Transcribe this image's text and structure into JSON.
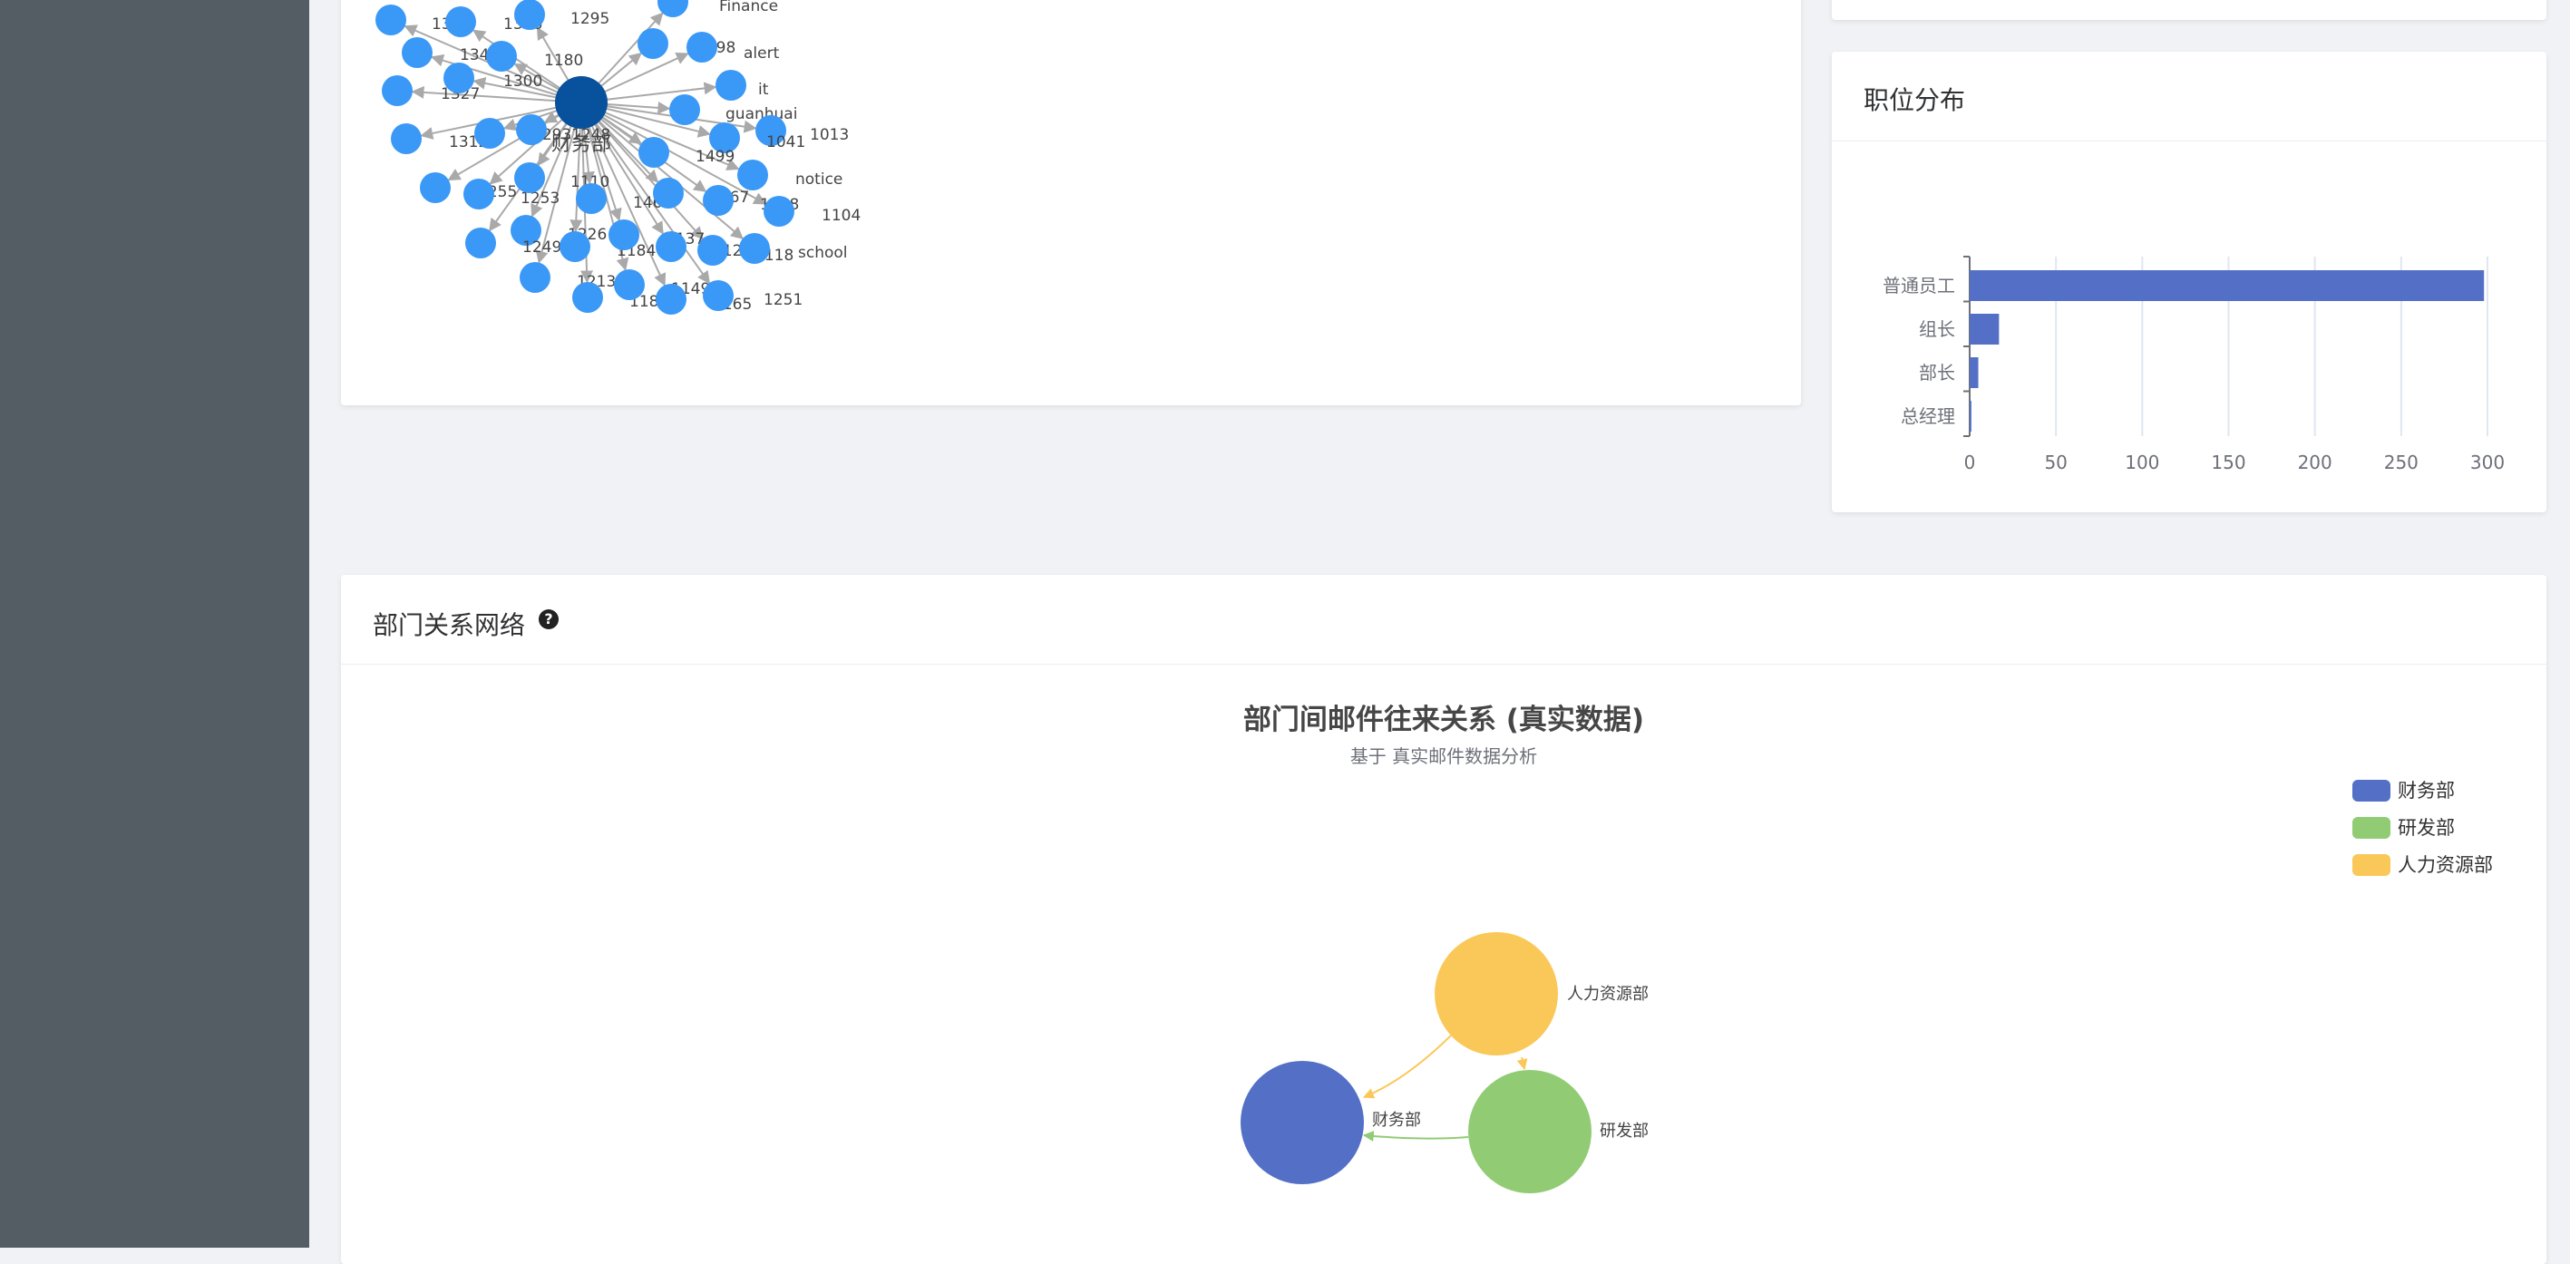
{
  "ego_network": {
    "center": {
      "label": "财务部",
      "color": "#08519c"
    },
    "nodes": [
      {
        "label": "1347"
      },
      {
        "label": "1346"
      },
      {
        "label": "1295"
      },
      {
        "label": "Finance"
      },
      {
        "label": "1342"
      },
      {
        "label": "1180"
      },
      {
        "label": "1498"
      },
      {
        "label": "alert"
      },
      {
        "label": "1327"
      },
      {
        "label": "1300"
      },
      {
        "label": "it"
      },
      {
        "label": "1312"
      },
      {
        "label": "1293"
      },
      {
        "label": "1248"
      },
      {
        "label": "guanhuai"
      },
      {
        "label": "1013"
      },
      {
        "label": "1041"
      },
      {
        "label": "1499"
      },
      {
        "label": "notice"
      },
      {
        "label": "1255"
      },
      {
        "label": "1253"
      },
      {
        "label": "1110"
      },
      {
        "label": "1467"
      },
      {
        "label": "1067"
      },
      {
        "label": "1108"
      },
      {
        "label": "1104"
      },
      {
        "label": "1226"
      },
      {
        "label": "1249"
      },
      {
        "label": "1184"
      },
      {
        "label": "1137"
      },
      {
        "label": "1124"
      },
      {
        "label": "1118"
      },
      {
        "label": "school"
      },
      {
        "label": "1213"
      },
      {
        "label": "1186"
      },
      {
        "label": "1149"
      },
      {
        "label": "1165"
      },
      {
        "label": "1251"
      }
    ],
    "node_color": "#3a98f7"
  },
  "position_card": {
    "title": "职位分布"
  },
  "chart_data": [
    {
      "type": "bar",
      "orientation": "horizontal",
      "categories": [
        "普通员工",
        "组长",
        "部长",
        "总经理"
      ],
      "values": [
        298,
        17,
        5,
        1
      ],
      "xlim": [
        0,
        300
      ],
      "xticks": [
        0,
        50,
        100,
        150,
        200,
        250,
        300
      ],
      "grid": true,
      "color": "#5470c6"
    }
  ],
  "dept_network": {
    "card_title": "部门关系网络",
    "help_icon": "question-circle-icon",
    "title": "部门间邮件往来关系 (真实数据)",
    "subtitle": "基于 真实邮件数据分析",
    "legend": [
      {
        "label": "财务部",
        "color": "#5470c6"
      },
      {
        "label": "研发部",
        "color": "#91cc75"
      },
      {
        "label": "人力资源部",
        "color": "#fac858"
      }
    ],
    "nodes": [
      {
        "label": "人力资源部",
        "color": "#fac858"
      },
      {
        "label": "财务部",
        "color": "#5470c6"
      },
      {
        "label": "研发部",
        "color": "#91cc75"
      }
    ]
  }
}
